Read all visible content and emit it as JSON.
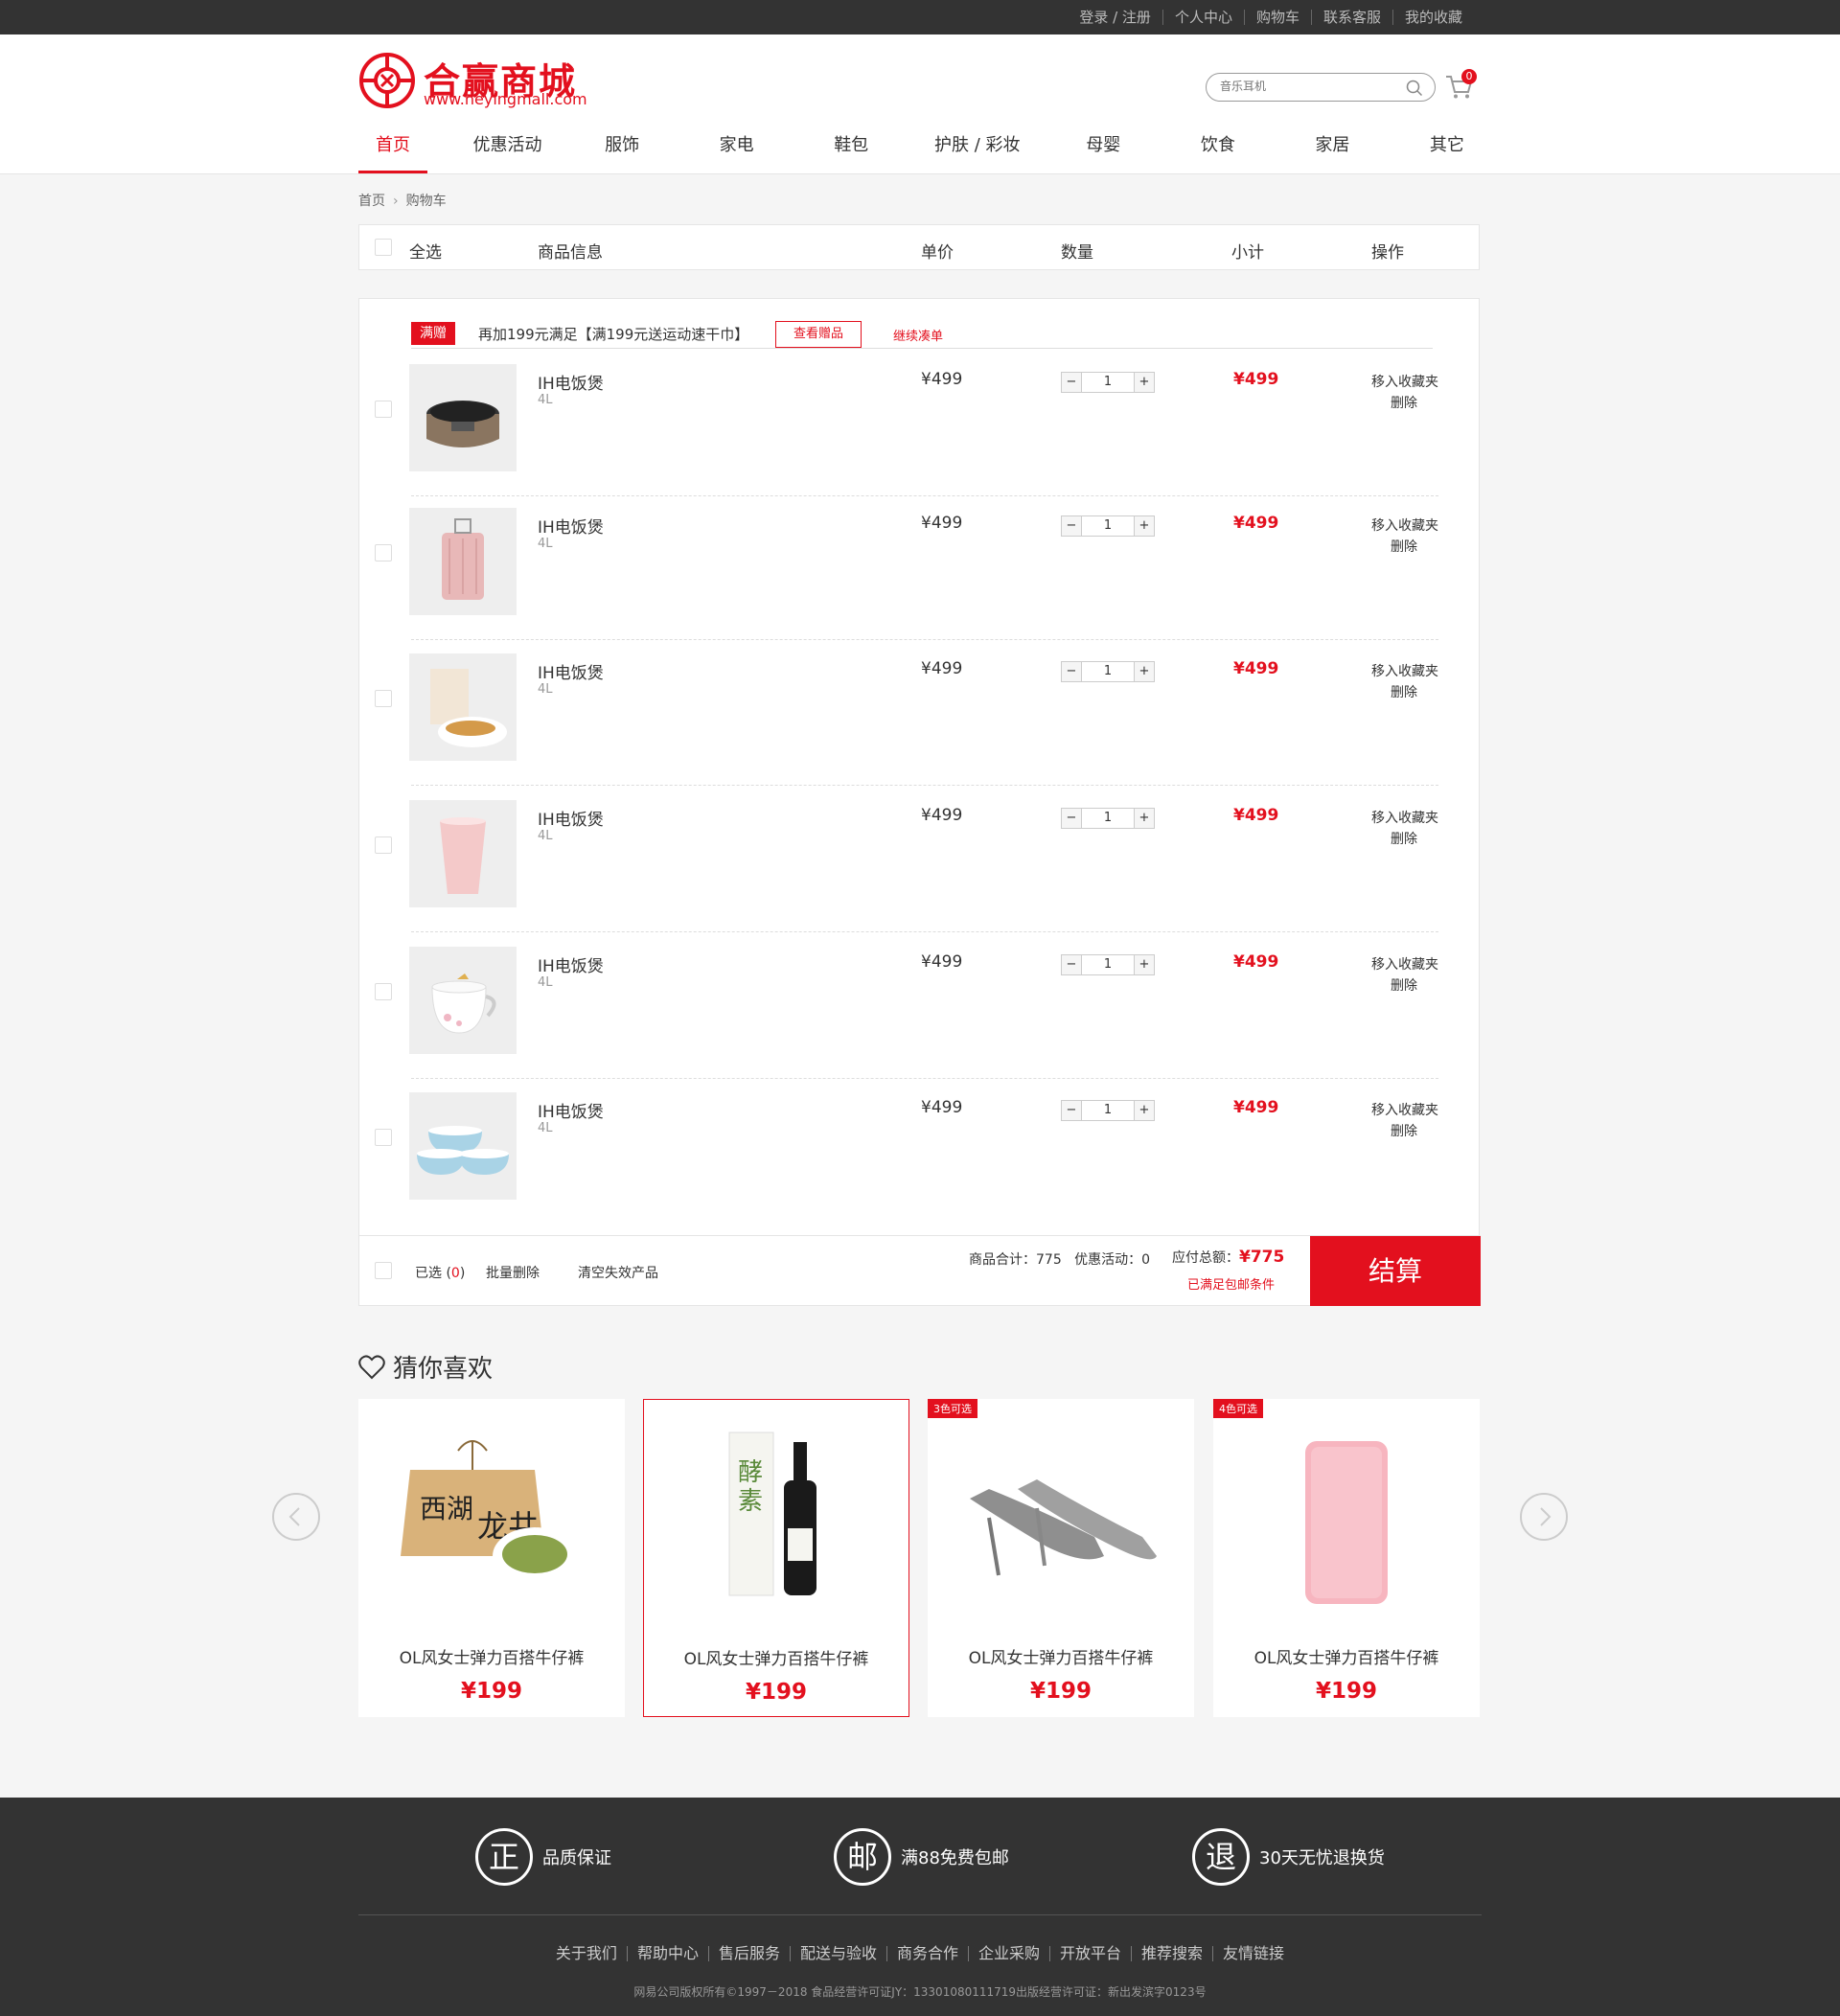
{
  "topbar": {
    "links": [
      "登录 / 注册",
      "个人中心",
      "购物车",
      "联系客服",
      "我的收藏"
    ]
  },
  "brand": {
    "name": "合赢商城",
    "url": "www.heyingmall.com",
    "color": "#e3101e"
  },
  "search": {
    "placeholder": "音乐耳机",
    "icon": "search-icon"
  },
  "cart": {
    "icon": "cart-icon",
    "count": "0"
  },
  "nav": {
    "items": [
      "首页",
      "优惠活动",
      "服饰",
      "家电",
      "鞋包",
      "护肤 / 彩妆",
      "母婴",
      "饮食",
      "家居",
      "其它"
    ],
    "active": "首页"
  },
  "breadcrumb": {
    "home": "首页",
    "current": "购物车"
  },
  "table_header": {
    "select_all": "全选",
    "info": "商品信息",
    "price": "单价",
    "qty": "数量",
    "subtotal": "小计",
    "ops": "操作"
  },
  "promo": {
    "tag": "满赠",
    "text": "再加199元满足【满199元送运动速干巾】",
    "button": "查看赠品",
    "link": "继续凑单"
  },
  "items": [
    {
      "name": "IH电饭煲",
      "spec": "4L",
      "price": "¥499",
      "qty": "1",
      "subtotal": "¥499",
      "fav": "移入收藏夹",
      "del": "删除",
      "image": "rice-cooker"
    },
    {
      "name": "IH电饭煲",
      "spec": "4L",
      "price": "¥499",
      "qty": "1",
      "subtotal": "¥499",
      "fav": "移入收藏夹",
      "del": "删除",
      "image": "suitcase"
    },
    {
      "name": "IH电饭煲",
      "spec": "4L",
      "price": "¥499",
      "qty": "1",
      "subtotal": "¥499",
      "fav": "移入收藏夹",
      "del": "删除",
      "image": "snack"
    },
    {
      "name": "IH电饭煲",
      "spec": "4L",
      "price": "¥499",
      "qty": "1",
      "subtotal": "¥499",
      "fav": "移入收藏夹",
      "del": "删除",
      "image": "cup"
    },
    {
      "name": "IH电饭煲",
      "spec": "4L",
      "price": "¥499",
      "qty": "1",
      "subtotal": "¥499",
      "fav": "移入收藏夹",
      "del": "删除",
      "image": "teacup"
    },
    {
      "name": "IH电饭煲",
      "spec": "4L",
      "price": "¥499",
      "qty": "1",
      "subtotal": "¥499",
      "fav": "移入收藏夹",
      "del": "删除",
      "image": "bowls"
    }
  ],
  "cart_footer": {
    "selected_label": "已选",
    "selected_count": "0",
    "batch_delete": "批量删除",
    "clear_invalid": "清空失效产品",
    "sum_label": "商品合计：",
    "sum_value": "775",
    "promo_label": "优惠活动：",
    "promo_value": "0",
    "total_label": "应付总额：",
    "total_value": "¥775",
    "free_shipping": "已满足包邮条件",
    "checkout": "结算"
  },
  "guess": {
    "title": "猜你喜欢",
    "products": [
      {
        "name": "OL风女士弹力百搭牛仔裤",
        "price": "¥199",
        "tag": "",
        "image": "tea-package"
      },
      {
        "name": "OL风女士弹力百搭牛仔裤",
        "price": "¥199",
        "tag": "",
        "image": "wine-bottle"
      },
      {
        "name": "OL风女士弹力百搭牛仔裤",
        "price": "¥199",
        "tag": "3色可选",
        "image": "high-heels"
      },
      {
        "name": "OL风女士弹力百搭牛仔裤",
        "price": "¥199",
        "tag": "4色可选",
        "image": "power-bank"
      }
    ]
  },
  "promises": [
    {
      "char": "正",
      "text": "品质保证"
    },
    {
      "char": "邮",
      "text": "满88免费包邮"
    },
    {
      "char": "退",
      "text": "30天无忧退换货"
    }
  ],
  "footer_links": [
    "关于我们",
    "帮助中心",
    "售后服务",
    "配送与验收",
    "商务合作",
    "企业采购",
    "开放平台",
    "推荐搜索",
    "友情链接"
  ],
  "copyright": "网易公司版权所有©1997－2018   食品经营许可证JY：13301080111719出版经营许可证：新出发滨字0123号"
}
